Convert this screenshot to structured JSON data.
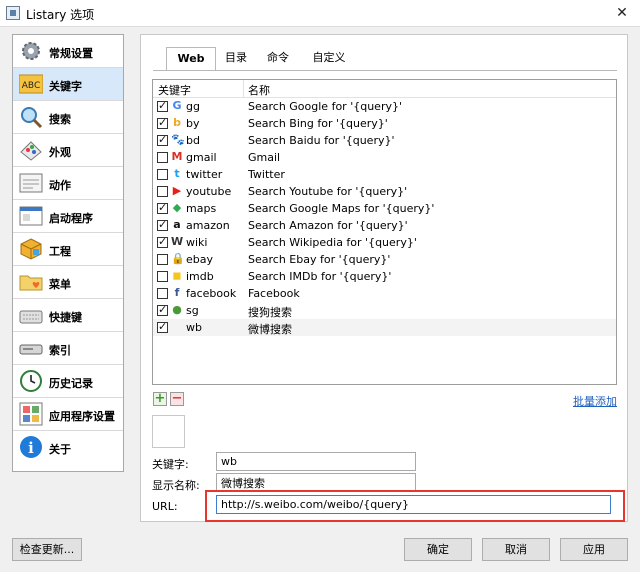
{
  "window": {
    "title": "Listary 选项",
    "close_glyph": "✕"
  },
  "nav": {
    "items": [
      {
        "label": "常规设置",
        "icon": "gear-icon"
      },
      {
        "label": "关键字",
        "icon": "abc-icon",
        "icon_text": "ABC"
      },
      {
        "label": "搜索",
        "icon": "magnifier-icon"
      },
      {
        "label": "外观",
        "icon": "palette-icon"
      },
      {
        "label": "动作",
        "icon": "window-icon"
      },
      {
        "label": "启动程序",
        "icon": "launcher-icon"
      },
      {
        "label": "工程",
        "icon": "cube-icon"
      },
      {
        "label": "菜单",
        "icon": "folder-heart-icon"
      },
      {
        "label": "快捷键",
        "icon": "keyboard-icon"
      },
      {
        "label": "索引",
        "icon": "drive-icon"
      },
      {
        "label": "历史记录",
        "icon": "clock-icon"
      },
      {
        "label": "应用程序设置",
        "icon": "app-grid-icon"
      },
      {
        "label": "关于",
        "icon": "info-icon",
        "icon_text": "i"
      }
    ],
    "active_index": 1
  },
  "tabs": [
    {
      "label": "Web"
    },
    {
      "label": "目录"
    },
    {
      "label": "命令"
    },
    {
      "label": "自定义"
    }
  ],
  "list": {
    "columns": [
      "关键字",
      "名称"
    ],
    "rows": [
      {
        "checked": true,
        "icon": "google-icon",
        "glyph": "G",
        "color": "#4285f4",
        "key": "gg",
        "name": "Search Google for '{query}'"
      },
      {
        "checked": true,
        "icon": "bing-icon",
        "glyph": "b",
        "color": "#f5a623",
        "key": "by",
        "name": "Search Bing for '{query}'"
      },
      {
        "checked": true,
        "icon": "baidu-icon",
        "glyph": "🐾",
        "color": "#2932e1",
        "key": "bd",
        "name": "Search Baidu for '{query}'"
      },
      {
        "checked": false,
        "icon": "gmail-icon",
        "glyph": "M",
        "color": "#d93025",
        "key": "gmail",
        "name": "Gmail"
      },
      {
        "checked": false,
        "icon": "twitter-icon",
        "glyph": "t",
        "color": "#1da1f2",
        "key": "twitter",
        "name": "Twitter"
      },
      {
        "checked": false,
        "icon": "youtube-icon",
        "glyph": "▶",
        "color": "#e62117",
        "key": "youtube",
        "name": "Search Youtube for '{query}'"
      },
      {
        "checked": true,
        "icon": "maps-icon",
        "glyph": "◆",
        "color": "#34a853",
        "key": "maps",
        "name": "Search Google Maps for '{query}'"
      },
      {
        "checked": true,
        "icon": "amazon-icon",
        "glyph": "a",
        "color": "#111111",
        "key": "amazon",
        "name": "Search Amazon for '{query}'"
      },
      {
        "checked": true,
        "icon": "wikipedia-icon",
        "glyph": "W",
        "color": "#333333",
        "key": "wiki",
        "name": "Search Wikipedia for '{query}'"
      },
      {
        "checked": false,
        "icon": "ebay-icon",
        "glyph": "🔒",
        "color": "#333333",
        "key": "ebay",
        "name": "Search Ebay for '{query}'"
      },
      {
        "checked": false,
        "icon": "imdb-icon",
        "glyph": "◼",
        "color": "#f5c518",
        "key": "imdb",
        "name": "Search IMDb for '{query}'"
      },
      {
        "checked": false,
        "icon": "facebook-icon",
        "glyph": "f",
        "color": "#3b5998",
        "key": "facebook",
        "name": "Facebook"
      },
      {
        "checked": true,
        "icon": "sogou-icon",
        "glyph": "●",
        "color": "#4a9a3a",
        "key": "sg",
        "name": "搜狗搜索"
      },
      {
        "checked": true,
        "icon": "",
        "glyph": "",
        "color": "#000000",
        "key": "wb",
        "name": "微博搜索"
      }
    ],
    "selected_index": 13
  },
  "controls": {
    "add_glyph": "+",
    "remove_glyph": "−",
    "batch_add_label": "批量添加"
  },
  "form": {
    "keyword_label": "关键字:",
    "keyword_value": "wb",
    "display_name_label": "显示名称:",
    "display_name_value": "微博搜索",
    "url_label": "URL:",
    "url_value": "http://s.weibo.com/weibo/{query}"
  },
  "footer": {
    "check_update_label": "检查更新...",
    "ok_label": "确定",
    "cancel_label": "取消",
    "apply_label": "应用"
  },
  "colors": {
    "accent_red": "#e8352e",
    "link_blue": "#1f5fbf",
    "nav_active": "#d6e8fa"
  }
}
